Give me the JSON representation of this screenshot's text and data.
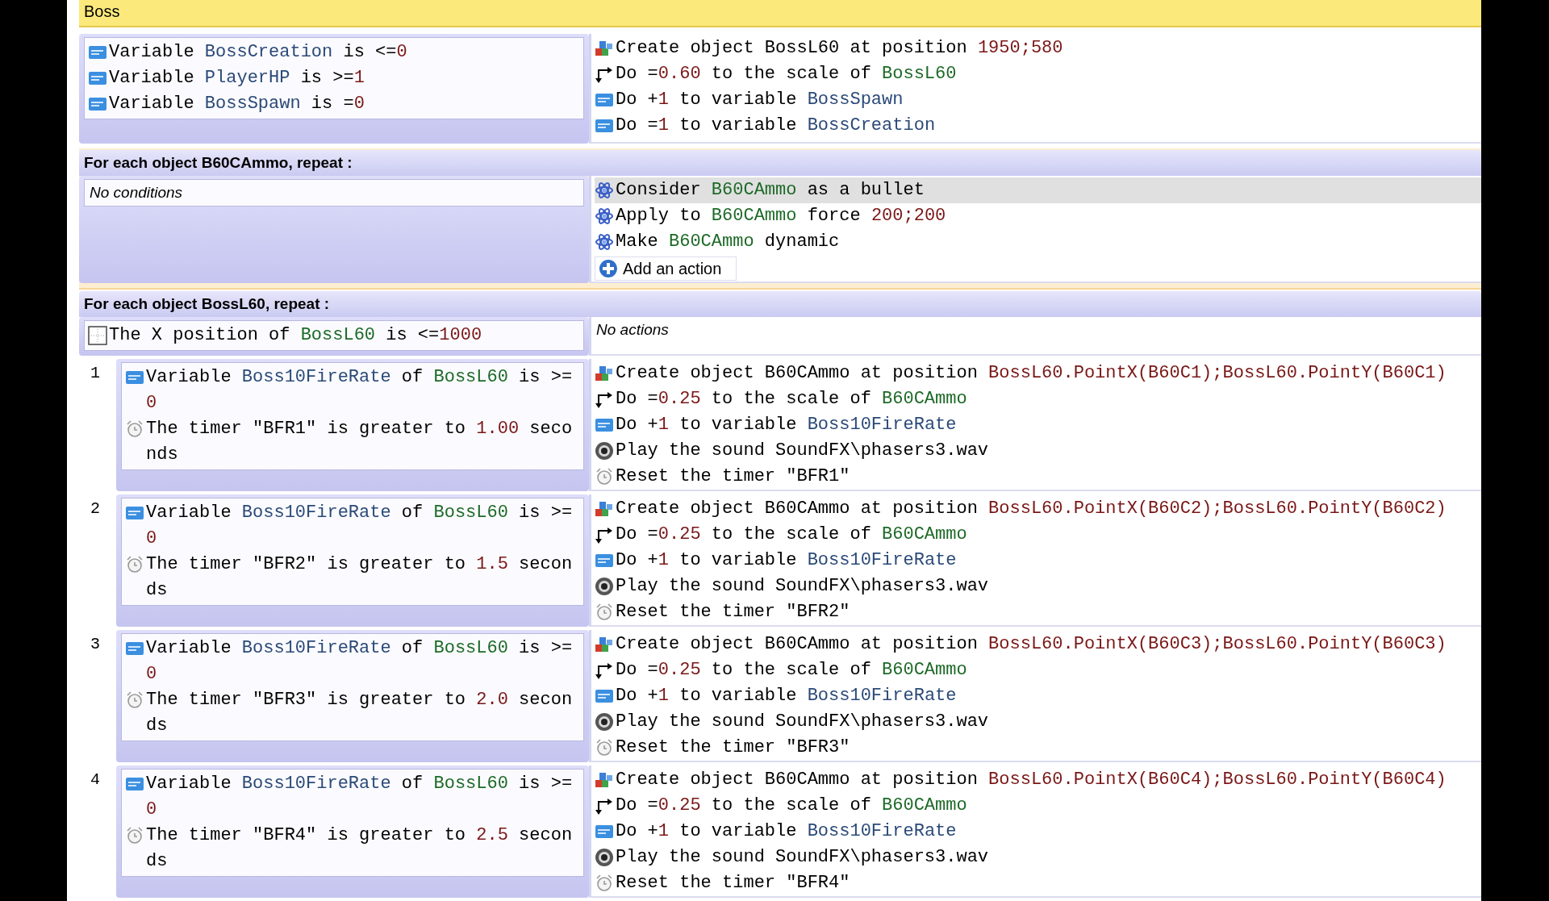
{
  "events": [
    {
      "kind": "comment",
      "selected": false,
      "text": "Boss"
    },
    {
      "kind": "standard",
      "selected": false,
      "conditions": [
        {
          "kind": "variable",
          "parts": [
            {
              "kind": "text",
              "text": "Variable "
            },
            {
              "kind": "variable",
              "text": "BossCreation"
            },
            {
              "kind": "text",
              "text": " is <="
            },
            {
              "kind": "value",
              "text": "0"
            }
          ]
        },
        {
          "kind": "variable",
          "parts": [
            {
              "kind": "text",
              "text": "Variable "
            },
            {
              "kind": "variable",
              "text": "PlayerHP"
            },
            {
              "kind": "text",
              "text": " is >="
            },
            {
              "kind": "value",
              "text": "1"
            }
          ]
        },
        {
          "kind": "variable",
          "parts": [
            {
              "kind": "text",
              "text": "Variable "
            },
            {
              "kind": "variable",
              "text": "BossSpawn"
            },
            {
              "kind": "text",
              "text": " is ="
            },
            {
              "kind": "value",
              "text": "0"
            }
          ]
        }
      ],
      "actions": [
        {
          "kind": "create",
          "parts": [
            {
              "kind": "text",
              "text": "Create object BossL60 at position "
            },
            {
              "kind": "value",
              "text": "1950;580"
            }
          ]
        },
        {
          "kind": "scale",
          "parts": [
            {
              "kind": "text",
              "text": "Do ="
            },
            {
              "kind": "value",
              "text": "0.60"
            },
            {
              "kind": "text",
              "text": " to the scale of "
            },
            {
              "kind": "object",
              "text": "BossL60"
            }
          ]
        },
        {
          "kind": "variable",
          "parts": [
            {
              "kind": "text",
              "text": "Do +"
            },
            {
              "kind": "value",
              "text": "1"
            },
            {
              "kind": "text",
              "text": " to variable "
            },
            {
              "kind": "variable",
              "text": "BossSpawn"
            }
          ]
        },
        {
          "kind": "variable",
          "parts": [
            {
              "kind": "text",
              "text": "Do ="
            },
            {
              "kind": "value",
              "text": "1"
            },
            {
              "kind": "text",
              "text": " to variable "
            },
            {
              "kind": "variable",
              "text": "BossCreation"
            }
          ]
        }
      ]
    },
    {
      "kind": "foreach",
      "selected": true,
      "header": "For each object B60CAmmo, repeat :",
      "no_conditions": "No conditions",
      "actions": [
        {
          "kind": "physics",
          "highlighted": true,
          "parts": [
            {
              "kind": "text",
              "text": "Consider "
            },
            {
              "kind": "object",
              "text": "B60CAmmo"
            },
            {
              "kind": "text",
              "text": " as a bullet"
            }
          ]
        },
        {
          "kind": "physics",
          "highlighted": false,
          "parts": [
            {
              "kind": "text",
              "text": "Apply to "
            },
            {
              "kind": "object",
              "text": "B60CAmmo"
            },
            {
              "kind": "text",
              "text": " force "
            },
            {
              "kind": "value",
              "text": "200;200"
            }
          ]
        },
        {
          "kind": "physics",
          "highlighted": false,
          "parts": [
            {
              "kind": "text",
              "text": "Make "
            },
            {
              "kind": "object",
              "text": "B60CAmmo"
            },
            {
              "kind": "text",
              "text": " dynamic"
            }
          ]
        }
      ],
      "add_action": "Add an action"
    },
    {
      "kind": "foreach",
      "selected": false,
      "header": "For each object BossL60, repeat :",
      "no_actions": "No actions",
      "conditions": [
        {
          "kind": "position",
          "parts": [
            {
              "kind": "text",
              "text": "The X position of "
            },
            {
              "kind": "object",
              "text": "BossL60"
            },
            {
              "kind": "text",
              "text": " is <="
            },
            {
              "kind": "value",
              "text": "1000"
            }
          ]
        }
      ],
      "subevents": [
        {
          "number": "1",
          "conditions": [
            {
              "kind": "variable",
              "parts": [
                {
                  "kind": "text",
                  "text": "Variable "
                },
                {
                  "kind": "variable",
                  "text": "Boss10FireRate"
                },
                {
                  "kind": "text",
                  "text": " of "
                },
                {
                  "kind": "object",
                  "text": "BossL60"
                },
                {
                  "kind": "text",
                  "text": " is >= "
                },
                {
                  "kind": "value",
                  "text": "0"
                }
              ]
            },
            {
              "kind": "timer",
              "parts": [
                {
                  "kind": "text",
                  "text": "The timer \"BFR1\" is greater to "
                },
                {
                  "kind": "value",
                  "text": "1.00"
                },
                {
                  "kind": "text",
                  "text": " seconds"
                }
              ]
            }
          ],
          "actions": [
            {
              "kind": "create",
              "parts": [
                {
                  "kind": "text",
                  "text": "Create object B60CAmmo at position "
                },
                {
                  "kind": "value",
                  "text": "BossL60.PointX(B60C1);BossL60.PointY(B60C1)"
                }
              ]
            },
            {
              "kind": "scale",
              "parts": [
                {
                  "kind": "text",
                  "text": "Do ="
                },
                {
                  "kind": "value",
                  "text": "0.25"
                },
                {
                  "kind": "text",
                  "text": " to the scale of "
                },
                {
                  "kind": "object",
                  "text": "B60CAmmo"
                }
              ]
            },
            {
              "kind": "variable",
              "parts": [
                {
                  "kind": "text",
                  "text": "Do +"
                },
                {
                  "kind": "value",
                  "text": "1"
                },
                {
                  "kind": "text",
                  "text": " to variable "
                },
                {
                  "kind": "variable",
                  "text": "Boss10FireRate"
                }
              ]
            },
            {
              "kind": "sound",
              "parts": [
                {
                  "kind": "text",
                  "text": "Play the sound SoundFX\\phasers3.wav"
                }
              ]
            },
            {
              "kind": "timer",
              "parts": [
                {
                  "kind": "text",
                  "text": "Reset the timer \"BFR1\""
                }
              ]
            }
          ]
        },
        {
          "number": "2",
          "conditions": [
            {
              "kind": "variable",
              "parts": [
                {
                  "kind": "text",
                  "text": "Variable "
                },
                {
                  "kind": "variable",
                  "text": "Boss10FireRate"
                },
                {
                  "kind": "text",
                  "text": " of "
                },
                {
                  "kind": "object",
                  "text": "BossL60"
                },
                {
                  "kind": "text",
                  "text": " is >= "
                },
                {
                  "kind": "value",
                  "text": "0"
                }
              ]
            },
            {
              "kind": "timer",
              "parts": [
                {
                  "kind": "text",
                  "text": "The timer \"BFR2\" is greater to "
                },
                {
                  "kind": "value",
                  "text": "1.5"
                },
                {
                  "kind": "text",
                  "text": " seconds"
                }
              ]
            }
          ],
          "actions": [
            {
              "kind": "create",
              "parts": [
                {
                  "kind": "text",
                  "text": "Create object B60CAmmo at position "
                },
                {
                  "kind": "value",
                  "text": "BossL60.PointX(B60C2);BossL60.PointY(B60C2)"
                }
              ]
            },
            {
              "kind": "scale",
              "parts": [
                {
                  "kind": "text",
                  "text": "Do ="
                },
                {
                  "kind": "value",
                  "text": "0.25"
                },
                {
                  "kind": "text",
                  "text": " to the scale of "
                },
                {
                  "kind": "object",
                  "text": "B60CAmmo"
                }
              ]
            },
            {
              "kind": "variable",
              "parts": [
                {
                  "kind": "text",
                  "text": "Do +"
                },
                {
                  "kind": "value",
                  "text": "1"
                },
                {
                  "kind": "text",
                  "text": " to variable "
                },
                {
                  "kind": "variable",
                  "text": "Boss10FireRate"
                }
              ]
            },
            {
              "kind": "sound",
              "parts": [
                {
                  "kind": "text",
                  "text": "Play the sound SoundFX\\phasers3.wav"
                }
              ]
            },
            {
              "kind": "timer",
              "parts": [
                {
                  "kind": "text",
                  "text": "Reset the timer \"BFR2\""
                }
              ]
            }
          ]
        },
        {
          "number": "3",
          "conditions": [
            {
              "kind": "variable",
              "parts": [
                {
                  "kind": "text",
                  "text": "Variable "
                },
                {
                  "kind": "variable",
                  "text": "Boss10FireRate"
                },
                {
                  "kind": "text",
                  "text": " of "
                },
                {
                  "kind": "object",
                  "text": "BossL60"
                },
                {
                  "kind": "text",
                  "text": " is >= "
                },
                {
                  "kind": "value",
                  "text": "0"
                }
              ]
            },
            {
              "kind": "timer",
              "parts": [
                {
                  "kind": "text",
                  "text": "The timer \"BFR3\" is greater to "
                },
                {
                  "kind": "value",
                  "text": "2.0"
                },
                {
                  "kind": "text",
                  "text": " seconds"
                }
              ]
            }
          ],
          "actions": [
            {
              "kind": "create",
              "parts": [
                {
                  "kind": "text",
                  "text": "Create object B60CAmmo at position "
                },
                {
                  "kind": "value",
                  "text": "BossL60.PointX(B60C3);BossL60.PointY(B60C3)"
                }
              ]
            },
            {
              "kind": "scale",
              "parts": [
                {
                  "kind": "text",
                  "text": "Do ="
                },
                {
                  "kind": "value",
                  "text": "0.25"
                },
                {
                  "kind": "text",
                  "text": " to the scale of "
                },
                {
                  "kind": "object",
                  "text": "B60CAmmo"
                }
              ]
            },
            {
              "kind": "variable",
              "parts": [
                {
                  "kind": "text",
                  "text": "Do +"
                },
                {
                  "kind": "value",
                  "text": "1"
                },
                {
                  "kind": "text",
                  "text": " to variable "
                },
                {
                  "kind": "variable",
                  "text": "Boss10FireRate"
                }
              ]
            },
            {
              "kind": "sound",
              "parts": [
                {
                  "kind": "text",
                  "text": "Play the sound SoundFX\\phasers3.wav"
                }
              ]
            },
            {
              "kind": "timer",
              "parts": [
                {
                  "kind": "text",
                  "text": "Reset the timer \"BFR3\""
                }
              ]
            }
          ]
        },
        {
          "number": "4",
          "conditions": [
            {
              "kind": "variable",
              "parts": [
                {
                  "kind": "text",
                  "text": "Variable "
                },
                {
                  "kind": "variable",
                  "text": "Boss10FireRate"
                },
                {
                  "kind": "text",
                  "text": " of "
                },
                {
                  "kind": "object",
                  "text": "BossL60"
                },
                {
                  "kind": "text",
                  "text": " is >= "
                },
                {
                  "kind": "value",
                  "text": "0"
                }
              ]
            },
            {
              "kind": "timer",
              "parts": [
                {
                  "kind": "text",
                  "text": "The timer \"BFR4\" is greater to "
                },
                {
                  "kind": "value",
                  "text": "2.5"
                },
                {
                  "kind": "text",
                  "text": " seconds"
                }
              ]
            }
          ],
          "actions": [
            {
              "kind": "create",
              "parts": [
                {
                  "kind": "text",
                  "text": "Create object B60CAmmo at position "
                },
                {
                  "kind": "value",
                  "text": "BossL60.PointX(B60C4);BossL60.PointY(B60C4)"
                }
              ]
            },
            {
              "kind": "scale",
              "parts": [
                {
                  "kind": "text",
                  "text": "Do ="
                },
                {
                  "kind": "value",
                  "text": "0.25"
                },
                {
                  "kind": "text",
                  "text": " to the scale of "
                },
                {
                  "kind": "object",
                  "text": "B60CAmmo"
                }
              ]
            },
            {
              "kind": "variable",
              "parts": [
                {
                  "kind": "text",
                  "text": "Do +"
                },
                {
                  "kind": "value",
                  "text": "1"
                },
                {
                  "kind": "text",
                  "text": " to variable "
                },
                {
                  "kind": "variable",
                  "text": "Boss10FireRate"
                }
              ]
            },
            {
              "kind": "sound",
              "parts": [
                {
                  "kind": "text",
                  "text": "Play the sound SoundFX\\phasers3.wav"
                }
              ]
            },
            {
              "kind": "timer",
              "parts": [
                {
                  "kind": "text",
                  "text": "Reset the timer \"BFR4\""
                }
              ]
            }
          ]
        }
      ]
    }
  ]
}
